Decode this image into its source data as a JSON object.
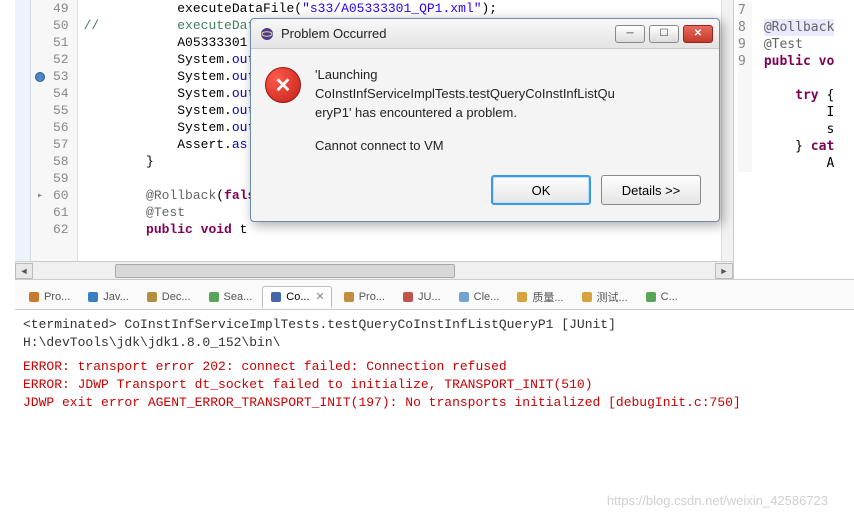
{
  "editor": {
    "lines": [
      {
        "n": 49,
        "indent": "            ",
        "segs": [
          [
            "",
            "executeDataFile("
          ],
          [
            "str",
            "\"s33/A05333301_QP1.xml\""
          ],
          [
            "",
            ");"
          ]
        ]
      },
      {
        "n": 50,
        "indent": "",
        "segs": [
          [
            "cmt",
            "//          "
          ],
          [
            "cmt",
            "executeDat"
          ]
        ]
      },
      {
        "n": 51,
        "indent": "            ",
        "segs": [
          [
            "",
            "A05333301"
          ]
        ]
      },
      {
        "n": 52,
        "indent": "            ",
        "segs": [
          [
            "",
            "System."
          ],
          [
            "fld",
            "out"
          ]
        ]
      },
      {
        "n": 53,
        "indent": "            ",
        "segs": [
          [
            "",
            "System."
          ],
          [
            "fld",
            "out"
          ]
        ],
        "bp": true
      },
      {
        "n": 54,
        "indent": "            ",
        "segs": [
          [
            "",
            "System."
          ],
          [
            "fld",
            "out"
          ]
        ]
      },
      {
        "n": 55,
        "indent": "            ",
        "segs": [
          [
            "",
            "System."
          ],
          [
            "fld",
            "out"
          ]
        ]
      },
      {
        "n": 56,
        "indent": "            ",
        "segs": [
          [
            "",
            "System."
          ],
          [
            "fld",
            "out"
          ]
        ]
      },
      {
        "n": 57,
        "indent": "            ",
        "segs": [
          [
            "",
            "Assert."
          ],
          [
            "fld",
            "as"
          ]
        ]
      },
      {
        "n": 58,
        "indent": "        ",
        "segs": [
          [
            "",
            "}"
          ]
        ]
      },
      {
        "n": 59,
        "indent": "",
        "segs": [
          [
            "",
            ""
          ]
        ]
      },
      {
        "n": 60,
        "indent": "        ",
        "segs": [
          [
            "ann",
            "@Rollback"
          ],
          [
            "",
            "("
          ],
          [
            "kw",
            "fals"
          ]
        ],
        "arrow": true
      },
      {
        "n": 61,
        "indent": "        ",
        "segs": [
          [
            "ann",
            "@Test"
          ]
        ]
      },
      {
        "n": 62,
        "indent": "        ",
        "segs": [
          [
            "kw",
            "public"
          ],
          [
            "",
            " "
          ],
          [
            "kw",
            "void"
          ],
          [
            "",
            " t"
          ]
        ]
      }
    ]
  },
  "right_editor": {
    "lines": [
      {
        "n": "7",
        "segs": [
          [
            "",
            ""
          ]
        ]
      },
      {
        "n": "8",
        "segs": [
          [
            "ann",
            "@Rollback"
          ]
        ],
        "hilite": true
      },
      {
        "n": "9",
        "segs": [
          [
            "ann",
            "@Test"
          ]
        ]
      },
      {
        "n": "9",
        "segs": [
          [
            "kw",
            "public"
          ],
          [
            "",
            " "
          ],
          [
            "kw",
            "vo"
          ]
        ]
      },
      {
        "n": "",
        "segs": [
          [
            "",
            ""
          ]
        ]
      },
      {
        "n": "",
        "segs": [
          [
            "",
            "    "
          ],
          [
            "kw",
            "try"
          ],
          [
            "",
            " {"
          ]
        ]
      },
      {
        "n": "",
        "segs": [
          [
            "",
            "        I"
          ]
        ]
      },
      {
        "n": "",
        "segs": [
          [
            "",
            "        s"
          ]
        ]
      },
      {
        "n": "",
        "segs": [
          [
            "",
            "    } "
          ],
          [
            "kw",
            "cat"
          ]
        ]
      },
      {
        "n": "",
        "segs": [
          [
            "",
            "        A"
          ]
        ]
      }
    ]
  },
  "tabs": [
    {
      "id": "problems",
      "label": "Pro...",
      "icon": "problems-icon",
      "color": "#c77a2e"
    },
    {
      "id": "javadoc",
      "label": "Jav...",
      "icon": "javadoc-icon",
      "color": "#3b7ec0"
    },
    {
      "id": "declaration",
      "label": "Dec...",
      "icon": "declaration-icon",
      "color": "#b38f3e"
    },
    {
      "id": "search",
      "label": "Sea...",
      "icon": "search-icon",
      "color": "#5aa458"
    },
    {
      "id": "console",
      "label": "Co...",
      "icon": "console-icon",
      "color": "#4466aa",
      "active": true
    },
    {
      "id": "progress",
      "label": "Pro...",
      "icon": "progress-icon",
      "color": "#c38d3b"
    },
    {
      "id": "junit",
      "label": "JU...",
      "icon": "junit-icon",
      "color": "#c0544a"
    },
    {
      "id": "cleanup",
      "label": "Cle...",
      "icon": "cleanup-icon",
      "color": "#6fa3d0"
    },
    {
      "id": "quality",
      "label": "质量...",
      "icon": "quality-cn-icon",
      "color": "#d8a33c"
    },
    {
      "id": "test",
      "label": "测试...",
      "icon": "test-cn-icon",
      "color": "#d8a33c"
    },
    {
      "id": "hierarchy",
      "label": "C...",
      "icon": "call-hierarchy-icon",
      "color": "#5aa458"
    }
  ],
  "console": {
    "header": "<terminated> CoInstInfServiceImplTests.testQueryCoInstInfListQueryP1 [JUnit] H:\\devTools\\jdk\\jdk1.8.0_152\\bin\\",
    "errors": [
      "ERROR: transport error 202: connect failed: Connection refused",
      "ERROR: JDWP Transport dt_socket failed to initialize, TRANSPORT_INIT(510)",
      "JDWP exit error AGENT_ERROR_TRANSPORT_INIT(197): No transports initialized [debugInit.c:750]"
    ]
  },
  "dialog": {
    "title": "Problem Occurred",
    "message_l1": "'Launching",
    "message_l2": "CoInstInfServiceImplTests.testQueryCoInstInfListQu",
    "message_l3": "eryP1' has encountered a problem.",
    "sub": "Cannot connect to VM",
    "ok": "OK",
    "details": "Details >>"
  },
  "watermark": "https://blog.csdn.net/weixin_42586723"
}
